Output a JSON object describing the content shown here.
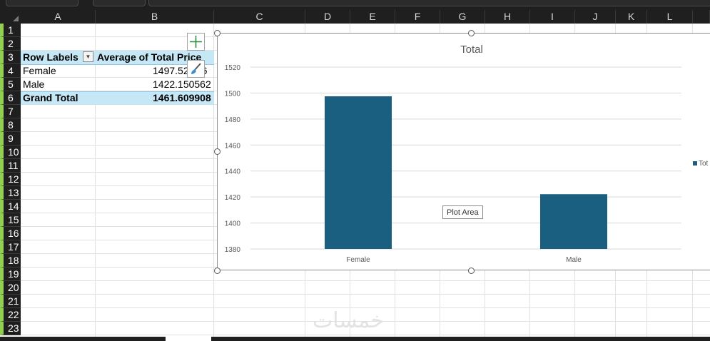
{
  "columns": [
    "A",
    "B",
    "C",
    "D",
    "E",
    "F",
    "G",
    "H",
    "I",
    "J",
    "K",
    "L"
  ],
  "rows": [
    "1",
    "2",
    "3",
    "4",
    "5",
    "6",
    "7",
    "8",
    "9",
    "10",
    "11",
    "12",
    "13",
    "14",
    "15",
    "16",
    "17",
    "18",
    "19",
    "20",
    "21",
    "22",
    "23"
  ],
  "pivot": {
    "header_row_labels": "Row Labels",
    "header_value": "Average of Total Price",
    "rows": [
      {
        "label": "Female",
        "value": "1497.52",
        "value_tail": "6"
      },
      {
        "label": "Male",
        "value": "1422.150562"
      }
    ],
    "grand_total_label": "Grand Total",
    "grand_total_value": "1461.609908"
  },
  "chart_data": {
    "type": "bar",
    "title": "Total",
    "categories": [
      "Female",
      "Male"
    ],
    "series": [
      {
        "name": "Tot",
        "values": [
          1497.5,
          1422.15
        ]
      }
    ],
    "ylim": [
      1380,
      1520
    ],
    "yticks": [
      1380,
      1400,
      1420,
      1440,
      1460,
      1480,
      1500,
      1520
    ],
    "bar_color": "#1a5f80",
    "grid": true,
    "legend": "right"
  },
  "tooltip": "Plot Area",
  "watermark": "خمسات",
  "colors": {
    "header_bg": "#1f1f1f",
    "row_header_accent": "#92d050",
    "pivot_header_bg": "#c6e7f5",
    "bar": "#1a5f80"
  }
}
